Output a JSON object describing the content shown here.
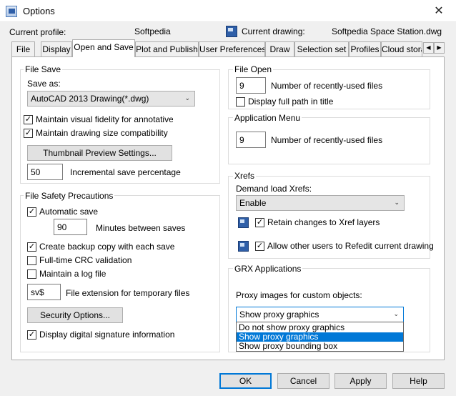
{
  "window": {
    "title": "Options",
    "close_glyph": "✕"
  },
  "header": {
    "current_profile_label": "Current profile:",
    "current_profile_value": "Softpedia",
    "current_drawing_label": "Current drawing:",
    "current_drawing_value": "Softpedia Space Station.dwg"
  },
  "tabs": [
    {
      "label": "File"
    },
    {
      "label": "Display"
    },
    {
      "label": "Open and Save",
      "active": true
    },
    {
      "label": "Plot and Publish"
    },
    {
      "label": "User Preferences"
    },
    {
      "label": "Draw"
    },
    {
      "label": "Selection set"
    },
    {
      "label": "Profiles"
    },
    {
      "label": "Cloud stora"
    }
  ],
  "tab_scroll": {
    "left": "◀",
    "right": "▶"
  },
  "file_save": {
    "title": "File Save",
    "save_as_label": "Save as:",
    "save_as_value": "AutoCAD 2013 Drawing(*.dwg)",
    "maintain_fidelity": {
      "label": "Maintain visual fidelity for annotative objec",
      "checked": true
    },
    "maintain_size": {
      "label": "Maintain drawing size compatibility",
      "checked": true
    },
    "thumbnail_button": "Thumbnail Preview Settings...",
    "incremental_value": "50",
    "incremental_label": "Incremental save percentage"
  },
  "file_safety": {
    "title": "File Safety Precautions",
    "automatic_save": {
      "label": "Automatic save",
      "checked": true
    },
    "minutes_value": "90",
    "minutes_label": "Minutes between saves",
    "backup_copy": {
      "label": "Create backup copy with each save",
      "checked": true
    },
    "crc_validation": {
      "label": "Full-time CRC validation",
      "checked": false
    },
    "log_file": {
      "label": "Maintain a log file",
      "checked": false
    },
    "temp_ext_value": "sv$",
    "temp_ext_label": "File extension for temporary files",
    "security_button": "Security Options...",
    "digital_signature": {
      "label": "Display digital signature information",
      "checked": true
    }
  },
  "file_open": {
    "title": "File Open",
    "recent_value": "9",
    "recent_label": "Number of recently-used files",
    "full_path": {
      "label": "Display full path in title",
      "checked": false
    }
  },
  "application_menu": {
    "title": "Application Menu",
    "recent_value": "9",
    "recent_label": "Number of recently-used files"
  },
  "xrefs": {
    "title": "Xrefs",
    "demand_load_label": "Demand load Xrefs:",
    "demand_load_value": "Enable",
    "retain_changes": {
      "label": "Retain changes to Xref layers",
      "checked": true
    },
    "allow_refedit": {
      "label": "Allow other users to Refedit current drawing",
      "checked": true
    }
  },
  "grx": {
    "title": "GRX Applications",
    "proxy_label": "Proxy images for custom objects:",
    "proxy_value": "Show proxy graphics",
    "proxy_options": [
      "Do not show proxy graphics",
      "Show proxy graphics",
      "Show proxy bounding box"
    ],
    "proxy_selected_index": 1
  },
  "buttons": {
    "ok": "OK",
    "cancel": "Cancel",
    "apply": "Apply",
    "help": "Help"
  },
  "glyphs": {
    "check": "✓",
    "combo_arrow": "⌄"
  },
  "colors": {
    "accent": "#0078d7",
    "window_bg": "#f0f0f0",
    "page_bg": "#ffffff"
  }
}
